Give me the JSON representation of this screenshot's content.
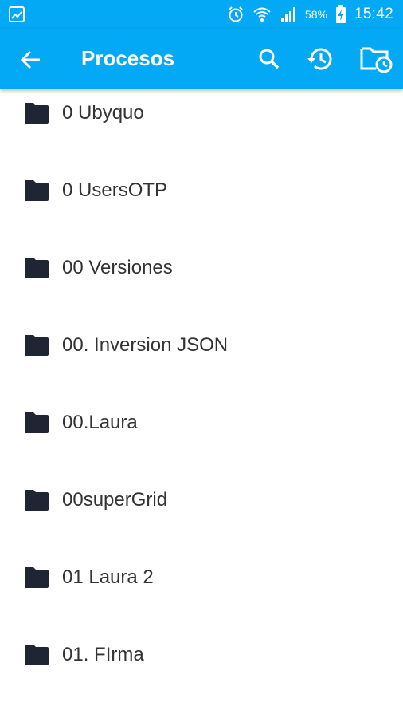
{
  "status_bar": {
    "battery_percent": "58%",
    "time": "15:42",
    "icons": [
      "image-icon",
      "alarm-icon",
      "wifi-icon",
      "signal-icon",
      "battery-charging-icon"
    ]
  },
  "app_bar": {
    "title": "Procesos",
    "actions": [
      "search-icon",
      "history-icon",
      "folder-clock-icon"
    ],
    "background": "#03A9F4"
  },
  "folders": [
    {
      "label": "0 Ubyquo"
    },
    {
      "label": "0 UsersOTP"
    },
    {
      "label": "00 Versiones"
    },
    {
      "label": "00. Inversion JSON"
    },
    {
      "label": "00.Laura"
    },
    {
      "label": "00superGrid"
    },
    {
      "label": "01 Laura 2"
    },
    {
      "label": "01. FIrma"
    }
  ]
}
